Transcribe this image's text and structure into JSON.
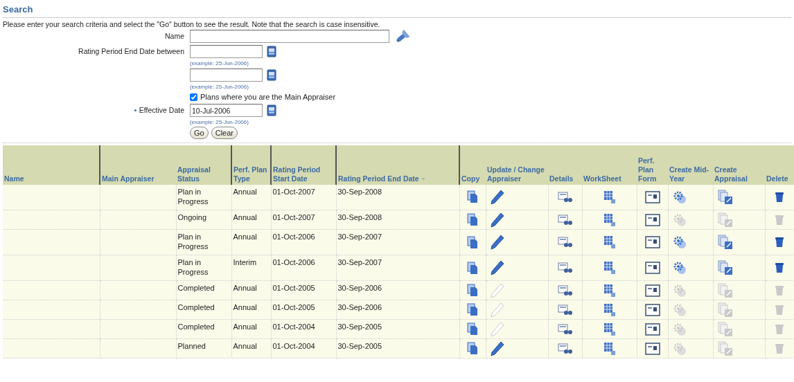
{
  "search": {
    "title": "Search",
    "instructions": "Please enter your search criteria and select the \"Go\" button to see the result. Note that the search is case insensitive.",
    "name_label": "Name",
    "end_date_label": "Rating Period End Date between",
    "example_hints": [
      "(example: 25-Jun-2006)",
      "(example: 25-Jun-2006)",
      "(example: 25-Jun-2006)"
    ],
    "main_appraiser_filter": {
      "label": "Plans where you are the Main Appraiser",
      "checked": true
    },
    "effective_date": {
      "label": "Effective Date",
      "required": true,
      "value": "10-Jul-2006"
    },
    "buttons": [
      "Go",
      "Clear"
    ]
  },
  "table": {
    "columns": [
      {
        "label": "Name",
        "sorted": false
      },
      {
        "label": "Main Appraiser",
        "sorted": false
      },
      {
        "label": "Appraisal Status",
        "sorted": false
      },
      {
        "label": "Perf. Plan Type",
        "sorted": false
      },
      {
        "label": "Rating Period Start Date",
        "sorted": false
      },
      {
        "label": "Rating Period End Date",
        "sorted": true
      },
      {
        "label": "Copy",
        "sorted": false
      },
      {
        "label": "Update / Change Appraiser",
        "sorted": false
      },
      {
        "label": "Details",
        "sorted": false
      },
      {
        "label": "WorkSheet",
        "sorted": false
      },
      {
        "label": "Perf. Plan Form",
        "sorted": false
      },
      {
        "label": "Create Mid-Year",
        "sorted": false
      },
      {
        "label": "Create Appraisal",
        "sorted": false
      },
      {
        "label": "Delete",
        "sorted": false
      }
    ],
    "rows": [
      {
        "status": "Plan in Progress",
        "plan_type": "Annual",
        "start": "01-Oct-2007",
        "end": "30-Sep-2008",
        "update_enabled": true,
        "midyear_enabled": true,
        "appraisal_enabled": true,
        "delete_enabled": true
      },
      {
        "status": "Ongoing",
        "plan_type": "Annual",
        "start": "01-Oct-2007",
        "end": "30-Sep-2008",
        "update_enabled": true,
        "midyear_enabled": false,
        "appraisal_enabled": false,
        "delete_enabled": false
      },
      {
        "status": "Plan in Progress",
        "plan_type": "Annual",
        "start": "01-Oct-2006",
        "end": "30-Sep-2007",
        "update_enabled": true,
        "midyear_enabled": true,
        "appraisal_enabled": true,
        "delete_enabled": true
      },
      {
        "status": "Plan in Progress",
        "plan_type": "Interim",
        "start": "01-Oct-2006",
        "end": "30-Sep-2007",
        "update_enabled": true,
        "midyear_enabled": true,
        "appraisal_enabled": true,
        "delete_enabled": true
      },
      {
        "status": "Completed",
        "plan_type": "Annual",
        "start": "01-Oct-2005",
        "end": "30-Sep-2006",
        "update_enabled": false,
        "midyear_enabled": false,
        "appraisal_enabled": false,
        "delete_enabled": false
      },
      {
        "status": "Completed",
        "plan_type": "Annual",
        "start": "01-Oct-2005",
        "end": "30-Sep-2006",
        "update_enabled": false,
        "midyear_enabled": false,
        "appraisal_enabled": false,
        "delete_enabled": false
      },
      {
        "status": "Completed",
        "plan_type": "Annual",
        "start": "01-Oct-2004",
        "end": "30-Sep-2005",
        "update_enabled": false,
        "midyear_enabled": false,
        "appraisal_enabled": false,
        "delete_enabled": false
      },
      {
        "status": "Planned",
        "plan_type": "Annual",
        "start": "01-Oct-2004",
        "end": "30-Sep-2005",
        "update_enabled": true,
        "midyear_enabled": false,
        "appraisal_enabled": false,
        "delete_enabled": false
      }
    ]
  }
}
